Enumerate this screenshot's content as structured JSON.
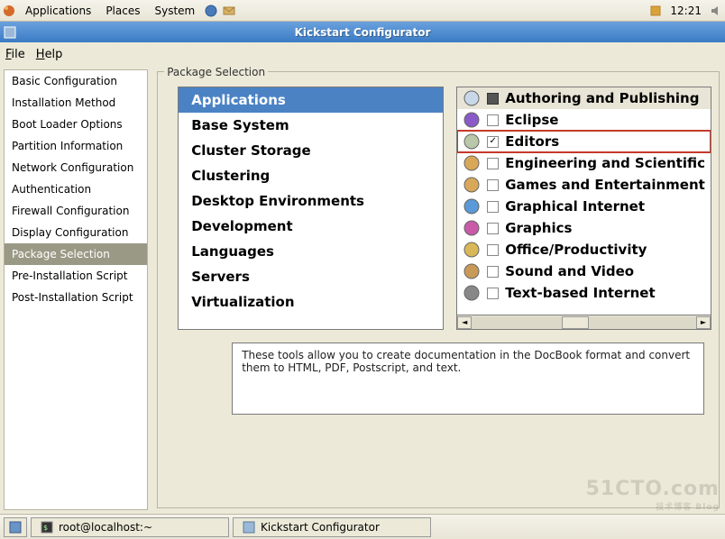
{
  "top_panel": {
    "apps": "Applications",
    "places": "Places",
    "system": "System",
    "clock": "12:21"
  },
  "window": {
    "title": "Kickstart Configurator"
  },
  "menubar": {
    "file": "File",
    "help": "Help"
  },
  "sidebar": {
    "items": [
      {
        "label": "Basic Configuration"
      },
      {
        "label": "Installation Method"
      },
      {
        "label": "Boot Loader Options"
      },
      {
        "label": "Partition Information"
      },
      {
        "label": "Network Configuration"
      },
      {
        "label": "Authentication"
      },
      {
        "label": "Firewall Configuration"
      },
      {
        "label": "Display Configuration"
      },
      {
        "label": "Package Selection"
      },
      {
        "label": "Pre-Installation Script"
      },
      {
        "label": "Post-Installation Script"
      }
    ],
    "selected_index": 8
  },
  "section_title": "Package Selection",
  "categories": {
    "items": [
      "Applications",
      "Base System",
      "Cluster Storage",
      "Clustering",
      "Desktop Environments",
      "Development",
      "Languages",
      "Servers",
      "Virtualization"
    ],
    "selected_index": 0
  },
  "groups": {
    "header": "Authoring and Publishing",
    "items": [
      {
        "label": "Eclipse",
        "checked": false
      },
      {
        "label": "Editors",
        "checked": true,
        "highlighted": true
      },
      {
        "label": "Engineering and Scientific",
        "checked": false
      },
      {
        "label": "Games and Entertainment",
        "checked": false
      },
      {
        "label": "Graphical Internet",
        "checked": false
      },
      {
        "label": "Graphics",
        "checked": false
      },
      {
        "label": "Office/Productivity",
        "checked": false
      },
      {
        "label": "Sound and Video",
        "checked": false
      },
      {
        "label": "Text-based Internet",
        "checked": false
      }
    ]
  },
  "description": "These tools allow you to create documentation in the DocBook format and convert them to HTML, PDF, Postscript, and text.",
  "taskbar": {
    "terminal": "root@localhost:~",
    "app": "Kickstart Configurator"
  },
  "watermark": {
    "main": "51CTO.com",
    "sub": "技术博客  Blog"
  }
}
